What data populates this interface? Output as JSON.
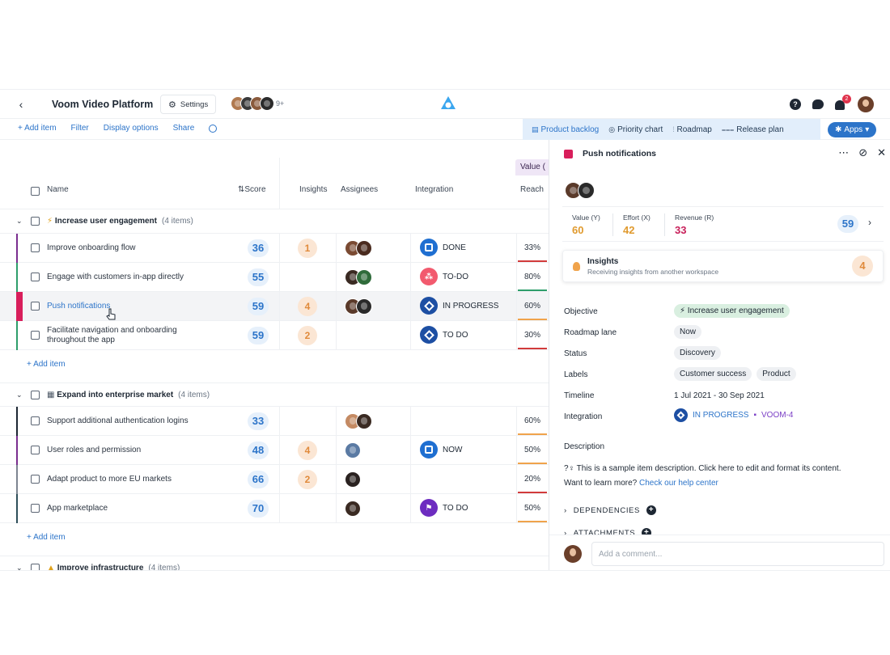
{
  "topbar": {
    "back_icon": "chevron-left-icon",
    "workspace_title": "Voom Video Platform",
    "settings_label": "Settings",
    "avatar_more": "9+"
  },
  "toolbar": {
    "add_item": "+ Add item",
    "filter": "Filter",
    "display_options": "Display options",
    "share": "Share",
    "views": [
      {
        "label": "Product backlog",
        "icon": "▤",
        "active": true
      },
      {
        "label": "Priority chart",
        "icon": "◎"
      },
      {
        "label": "Roadmap",
        "icon": "⫶"
      },
      {
        "label": "Release plan",
        "icon": "⩶"
      }
    ],
    "apps_label": "Apps",
    "notification_count": "2"
  },
  "table": {
    "headers": {
      "name": "Name",
      "score": "Score",
      "insights": "Insights",
      "assignees": "Assignees",
      "integration": "Integration",
      "value_group": "Value (",
      "reach": "Reach"
    },
    "groups": [
      {
        "emoji": "⚡",
        "name": "Increase user engagement",
        "count": "(4 items)",
        "items": [
          {
            "name": "Improve onboarding flow",
            "score": "36",
            "insights": "1",
            "integration": "DONE",
            "reach": "33%",
            "stripe": "#7b2f8f",
            "reach_color": "#d23b3b"
          },
          {
            "name": "Engage with customers in-app directly",
            "score": "55",
            "insights": "",
            "integration": "TO-DO",
            "reach": "80%",
            "stripe": "#2e9e6b",
            "reach_color": "#2e9e6b"
          },
          {
            "name": "Push notifications",
            "score": "59",
            "insights": "4",
            "integration": "IN PROGRESS",
            "reach": "60%",
            "stripe": "#d81e5b",
            "reach_color": "#f0a34b"
          },
          {
            "name": "Facilitate navigation and onboarding throughout the app",
            "score": "59",
            "insights": "2",
            "integration": "TO DO",
            "reach": "30%",
            "stripe": "#2e9e6b",
            "reach_color": "#d23b3b"
          }
        ],
        "add_item": "+ Add item"
      },
      {
        "emoji": "▦",
        "name": "Expand into enterprise market",
        "count": "(4 items)",
        "items": [
          {
            "name": "Support additional authentication logins",
            "score": "33",
            "insights": "",
            "integration": "",
            "reach": "60%",
            "stripe": "#1d2733",
            "reach_color": "#f0a34b"
          },
          {
            "name": "User roles and permission",
            "score": "48",
            "insights": "4",
            "integration": "NOW",
            "reach": "50%",
            "stripe": "#7b2f8f",
            "reach_color": "#f0a34b"
          },
          {
            "name": "Adapt product to more EU markets",
            "score": "66",
            "insights": "2",
            "integration": "",
            "reach": "20%",
            "stripe": "#7d8590",
            "reach_color": "#d23b3b"
          },
          {
            "name": "App marketplace",
            "score": "70",
            "insights": "",
            "integration": "TO DO",
            "reach": "50%",
            "stripe": "#2f4f5a",
            "reach_color": "#f0a34b"
          }
        ],
        "add_item": "+ Add item"
      },
      {
        "emoji": "▲",
        "name": "Improve infrastructure",
        "count": "(4 items)"
      }
    ]
  },
  "panel": {
    "title": "Push notifications",
    "metrics": {
      "value_label": "Value (Y)",
      "value": "60",
      "effort_label": "Effort (X)",
      "effort": "42",
      "revenue_label": "Revenue (R)",
      "revenue": "33",
      "score": "59"
    },
    "insights": {
      "title": "Insights",
      "subtitle": "Receiving insights from another workspace",
      "count": "4"
    },
    "fields": {
      "objective_label": "Objective",
      "objective": "⚡ Increase user engagement",
      "roadmap_lane_label": "Roadmap lane",
      "roadmap_lane": "Now",
      "status_label": "Status",
      "status": "Discovery",
      "labels_label": "Labels",
      "label_1": "Customer success",
      "label_2": "Product",
      "timeline_label": "Timeline",
      "timeline": "1 Jul 2021 - 30 Sep 2021",
      "integration_label": "Integration",
      "integration_status": "IN PROGRESS",
      "integration_key": "VOOM-4"
    },
    "description_title": "Description",
    "description_line1": "?♀ This is a sample item description. Click here to edit and format its content.",
    "description_line2_prefix": "Want to learn more? ",
    "description_link": "Check our help center",
    "dependencies": "DEPENDENCIES",
    "attachments": "ATTACHMENTS",
    "comment_placeholder": "Add a comment..."
  },
  "colors": {
    "accent": "#2c74c9",
    "value": "#e09a2e",
    "effort": "#e09a2e",
    "revenue": "#c8205a"
  }
}
